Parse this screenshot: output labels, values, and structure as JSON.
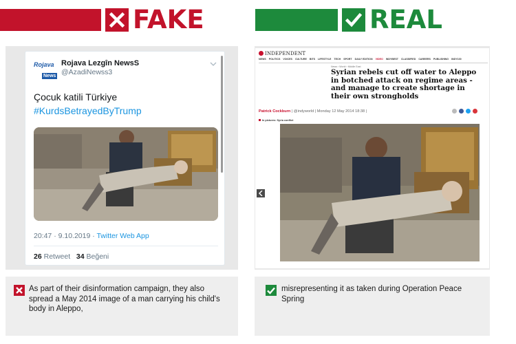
{
  "fake": {
    "title": "FAKE",
    "color": "#c2132b",
    "tweet": {
      "logo_top": "Rojava",
      "logo_bottom": "News",
      "account_name": "Rojava Lezgîn NewsS",
      "handle": "@AzadiNewss3",
      "text": "Çocuk katili Türkiye",
      "hashtag": "#KurdsBetrayedByTrump",
      "time_date": "20:47 · 9.10.2019 · ",
      "source_app": "Twitter Web App",
      "retweet_count": "26",
      "retweet_label": "Retweet",
      "like_count": "34",
      "like_label": "Beğeni"
    },
    "caption": "As part of their disinformation campaign, they also spread a May 2014 image of a man carrying his child's body in Aleppo,",
    "caption_icon": "x-icon"
  },
  "real": {
    "title": "REAL",
    "color": "#1d8a3c",
    "article": {
      "publication": "INDEPENDENT",
      "nav": [
        "NEWS",
        "POLITICS",
        "VOICES",
        "CULTURE",
        "BITS",
        "LIFESTYLE",
        "TECH",
        "SPORT",
        "DAILY EDITION",
        "VIDEO",
        "INDYBEST",
        "CLASSIFIED",
        "CAREERS",
        "PUBLISHING",
        "INDY100"
      ],
      "nav_active": "VIDEO",
      "crumb": "News › World › Middle East",
      "headline": "Syrian rebels cut off water to Aleppo in botched attack on regime areas - and manage to create shortage in their own strongholds",
      "author": "Patrick Cockburn",
      "byline_rest": " | @indyworld | Monday 12 May 2014 18:38 |",
      "tag": "In pictures: Syria conflict"
    },
    "caption": "misrepresenting it as taken during Operation Peace Spring",
    "caption_icon": "check-icon"
  }
}
